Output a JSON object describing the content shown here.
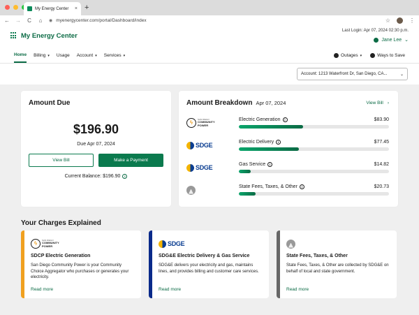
{
  "browser": {
    "tab_title": "My Energy Center",
    "tab_close": "×",
    "new_tab": "+",
    "url": "myenergycenter.com/portal/Dashboard/index",
    "nav_back": "←",
    "nav_forward": "→",
    "nav_reload": "C",
    "nav_home": "⌂",
    "star": "☆",
    "menu": "⋮",
    "traffic_colors": [
      "#ff5f57",
      "#febc2e",
      "#28c840"
    ]
  },
  "header": {
    "brand": "My Energy Center",
    "last_login": "Last Login: Apr 07, 2024 02:30 p.m.",
    "user_name": "Jane Lee",
    "user_caret": "⌄"
  },
  "nav": {
    "items": [
      {
        "label": "Home",
        "caret": ""
      },
      {
        "label": "Billing",
        "caret": "▾"
      },
      {
        "label": "Usage",
        "caret": ""
      },
      {
        "label": "Account",
        "caret": "▾"
      },
      {
        "label": "Services",
        "caret": "▾"
      }
    ],
    "right": [
      {
        "label": "Outages",
        "caret": "▾"
      },
      {
        "label": "Ways to Save",
        "caret": ""
      }
    ]
  },
  "account": {
    "selected": "Account: 1213 Waterfront Dr, San Diego, CA...",
    "caret": "⌄"
  },
  "amount_due": {
    "title": "Amount Due",
    "amount": "$196.90",
    "due": "Due Apr 07, 2024",
    "view_bill": "View Bill",
    "make_payment": "Make a Payment",
    "current_balance": "Current Balance: $196.90",
    "info": "i"
  },
  "breakdown": {
    "title": "Amount Breakdown",
    "date": "Apr 07, 2024",
    "view_bill": "View Bill",
    "view_bill_arrow": "›",
    "rows": [
      {
        "logo": "community-power",
        "label": "Electric Generation",
        "amount": "$83.90",
        "fill": 0.43
      },
      {
        "logo": "sdge",
        "label": "Electric Delivery",
        "amount": "$77.45",
        "fill": 0.4
      },
      {
        "logo": "sdge",
        "label": "Gas Service",
        "amount": "$14.82",
        "fill": 0.08
      },
      {
        "logo": "government",
        "label": "State Fees, Taxes, & Other",
        "amount": "$20.73",
        "fill": 0.11
      }
    ]
  },
  "logos": {
    "community_power_line1": "SAN DIEGO",
    "community_power_line2": "COMMUNITY",
    "community_power_line3": "POWER",
    "sdge": "SDGE"
  },
  "charges": {
    "title": "Your Charges Explained",
    "cards": [
      {
        "logo": "community-power",
        "accent": "#f0a020",
        "title": "SDCP Electric Generation",
        "desc": "San Diego Community Power is your Community Choice Aggregator who purchases or generates your electricity.",
        "link": "Read more"
      },
      {
        "logo": "sdge",
        "accent": "#0a2a8a",
        "title": "SDG&E Electric Delivery & Gas Service",
        "desc": "SDG&E delivers your electricity and gas, maintains lines, and provides billing and customer care services.",
        "link": "Read more"
      },
      {
        "logo": "government",
        "accent": "#666666",
        "title": "State Fees, Taxes, & Other",
        "desc": "State Fees, Taxes, & Other are collected by SDG&E on behalf of local and state government.",
        "link": "Read more"
      }
    ]
  }
}
